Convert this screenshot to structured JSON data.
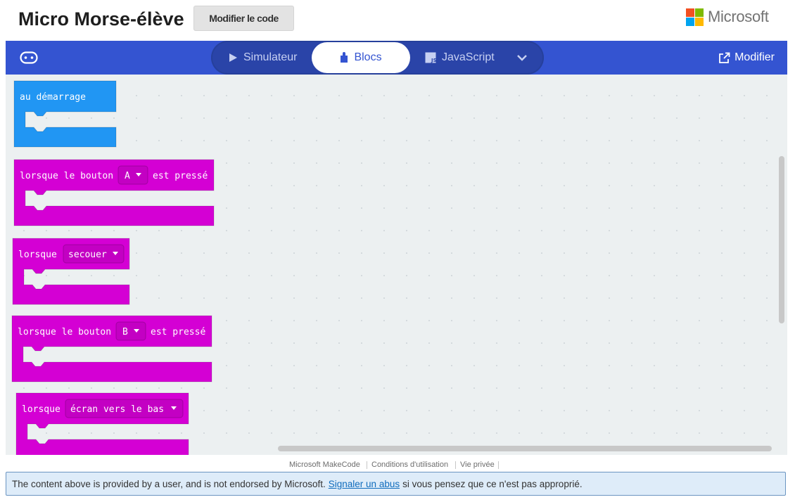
{
  "header": {
    "title": "Micro Morse-élève",
    "edit_code_label": "Modifier le code",
    "brand": "Microsoft"
  },
  "toolbar": {
    "tabs": [
      {
        "label": "Simulateur",
        "icon": "play-icon",
        "selected": false
      },
      {
        "label": "Blocs",
        "icon": "puzzle-icon",
        "selected": true
      },
      {
        "label": "JavaScript",
        "icon": "js-icon",
        "selected": false
      }
    ],
    "modify_label": "Modifier"
  },
  "blocks": [
    {
      "type": "event",
      "color": "#2196f3",
      "parts": [
        "au démarrage"
      ]
    },
    {
      "type": "event",
      "color": "#d400d4",
      "parts": [
        "lorsque le bouton",
        "A",
        "est pressé"
      ]
    },
    {
      "type": "event",
      "color": "#d400d4",
      "parts": [
        "lorsque",
        "secouer"
      ]
    },
    {
      "type": "event",
      "color": "#d400d4",
      "parts": [
        "lorsque le bouton",
        "B",
        "est pressé"
      ]
    },
    {
      "type": "event",
      "color": "#d400d4",
      "parts": [
        "lorsque",
        "écran vers le bas"
      ]
    }
  ],
  "footer": {
    "links": [
      "Microsoft MakeCode",
      "Conditions d'utilisation",
      "Vie privée"
    ]
  },
  "notice": {
    "before": "The content above is provided by a user, and is not endorsed by Microsoft.",
    "link": "Signaler un abus",
    "after": "si vous pensez que ce n'est pas approprié."
  },
  "colors": {
    "toolbar": "#3454d1",
    "loops_blue": "#2196f3",
    "input_magenta": "#d400d4",
    "workspace": "#ecf0f1"
  }
}
